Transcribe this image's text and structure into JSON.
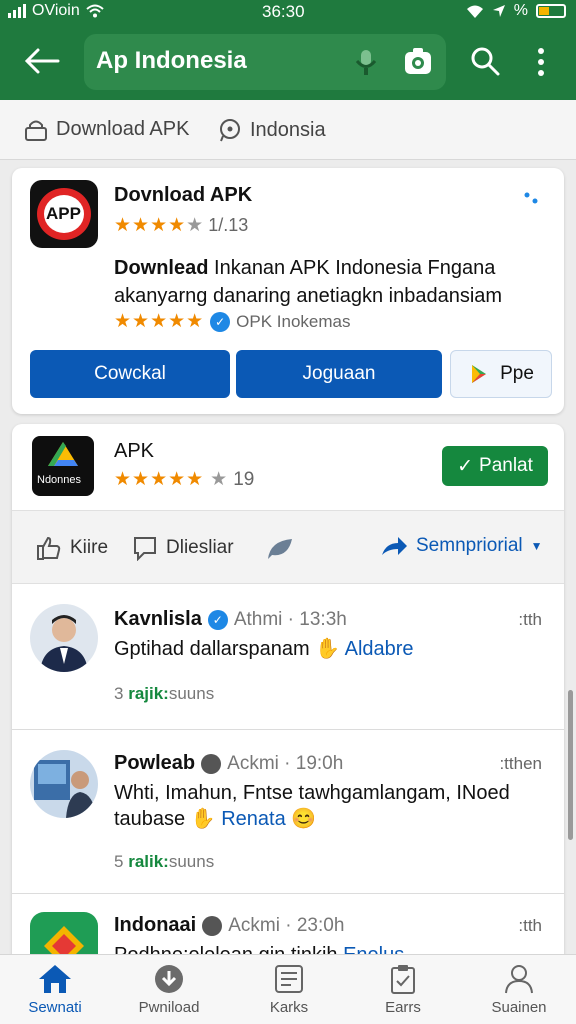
{
  "status": {
    "carrier": "OVioin",
    "time": "36:30",
    "battery_label": "%"
  },
  "appbar": {
    "query": "Ap Indonesia"
  },
  "filters": [
    {
      "label": "Download APK",
      "icon": "lock-icon"
    },
    {
      "label": "Indonsia",
      "icon": "location-icon"
    }
  ],
  "card1": {
    "title": "Dovnload APK",
    "rating": "1/.13",
    "desc_bold": "Downlead",
    "desc_rest": " Inkanan APK Indonesia Fngana akanyarng danaring anetiagkn inbadansiam",
    "meta": "OPK Inokemas",
    "icon_text": "APP",
    "buttons": [
      "Cowckal",
      "Joguaan",
      "Ppe"
    ]
  },
  "card2": {
    "title": "APK",
    "rating": "19",
    "icon_label": "Ndonnes",
    "install_label": "Panlat",
    "actions": [
      "Kiire",
      "Dliesliar",
      "Semnpriorial"
    ]
  },
  "posts": [
    {
      "name": "Kavnlisla",
      "time": "Athmi · 13:3h",
      "menu": ":tth",
      "text": "Gptihad dallarspanam",
      "highlight": "Aldabre",
      "count": "3",
      "count_word": "rajik:",
      "count_tail": "suuns"
    },
    {
      "name": "Powleab",
      "time": "Ackmi · 19:0h",
      "menu": ":tthen",
      "text": "Whti, Imahun, Fntse tawhgamlangam, INoed taubase",
      "highlight": "Renata",
      "count": "5",
      "count_word": "ralik:",
      "count_tail": "suuns"
    },
    {
      "name": "Indonaai",
      "time": "Ackmi · 23:0h",
      "menu": ":tth",
      "text": "Podhne:elelean gin tinkih",
      "highlight": "Enelus"
    }
  ],
  "nav": [
    {
      "label": "Sewnati",
      "icon": "home-icon"
    },
    {
      "label": "Pwniload",
      "icon": "download-icon"
    },
    {
      "label": "Karks",
      "icon": "grid-icon"
    },
    {
      "label": "Earrs",
      "icon": "clipboard-icon"
    },
    {
      "label": "Suainen",
      "icon": "person-icon"
    }
  ],
  "colors": {
    "brand_green": "#1f7a3e",
    "accent_blue": "#0b59b5",
    "star": "#f08a00"
  }
}
